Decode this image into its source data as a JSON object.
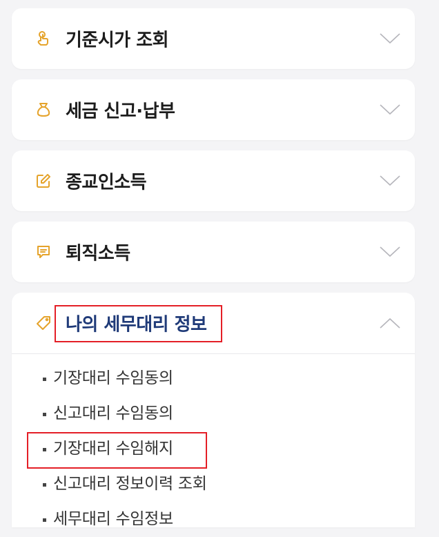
{
  "colors": {
    "page_bg": "#f4f4f6",
    "card_bg": "#ffffff",
    "icon_gold": "#e5a32b",
    "open_title": "#1f3a78",
    "highlight": "#e41e26"
  },
  "sections": [
    {
      "title": "기준시가 조회",
      "icon": "hand-touch-icon",
      "expanded": false
    },
    {
      "title": "세금 신고·납부",
      "icon": "money-bag-icon",
      "expanded": false
    },
    {
      "title": "종교인소득",
      "icon": "edit-icon",
      "expanded": false
    },
    {
      "title": "퇴직소득",
      "icon": "message-icon",
      "expanded": false
    },
    {
      "title": "나의 세무대리 정보",
      "icon": "tag-icon",
      "expanded": true,
      "highlighted": true,
      "items": [
        {
          "label": "기장대리 수임동의",
          "highlighted": false
        },
        {
          "label": "신고대리 수임동의",
          "highlighted": false
        },
        {
          "label": "기장대리 수임해지",
          "highlighted": true
        },
        {
          "label": "신고대리 정보이력 조회",
          "highlighted": false
        },
        {
          "label": "세무대리 수임정보",
          "highlighted": false
        }
      ]
    }
  ]
}
